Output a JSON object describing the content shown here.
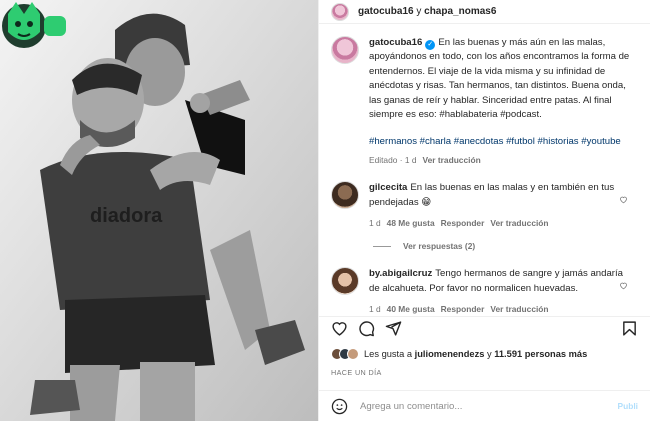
{
  "header": {
    "user": "gatocuba16",
    "joiner": " y ",
    "collab": "chapa_nomas6"
  },
  "caption": {
    "user": "gatocuba16",
    "text": "En las buenas y más aún en las malas, apoyándonos en todo, con los años encontramos la forma de entendernos. El viaje de la vida misma y su infinidad de anécdotas y risas. Tan hermanos, tan distintos. Buena onda, las ganas de reír y hablar. Sinceridad entre patas. Al final siempre es eso: #hablabateria #podcast.",
    "tags": "#hermanos #charla #anecdotas #futbol #historias #youtube",
    "edited": "Editado · 1 d",
    "translate": "Ver traducción"
  },
  "comments": [
    {
      "user": "gilcecita",
      "text": "En las buenas en las malas y en también en tus pendejadas",
      "emoji": "😁",
      "age": "1 d",
      "likes": "48 Me gusta",
      "reply": "Responder",
      "translate": "Ver traducción"
    },
    {
      "user": "by.abigailcruz",
      "text": "Tengo hermanos de sangre y jamás andaría de alcahueta. Por favor no normalicen huevadas.",
      "age": "1 d",
      "likes": "40 Me gusta",
      "reply": "Responder",
      "translate": "Ver traducción"
    }
  ],
  "view_replies": "Ver respuestas (2)",
  "likes": {
    "prefix": "Les gusta a ",
    "first_user": "juliomenendezs",
    "middle": " y ",
    "count": "11.591 personas más"
  },
  "date": "HACE UN DÍA",
  "composer": {
    "placeholder": "Agrega un comentario...",
    "publish": "Publi"
  },
  "icons": {
    "like": "heart-icon",
    "comment": "comment-icon",
    "share": "share-icon",
    "save": "bookmark-icon",
    "emoji": "emoji-icon",
    "verified": "verified-badge-icon"
  },
  "colors": {
    "link": "#00376b",
    "muted": "#737373",
    "verified": "#0095f6",
    "logo_green": "#2ecc71"
  }
}
